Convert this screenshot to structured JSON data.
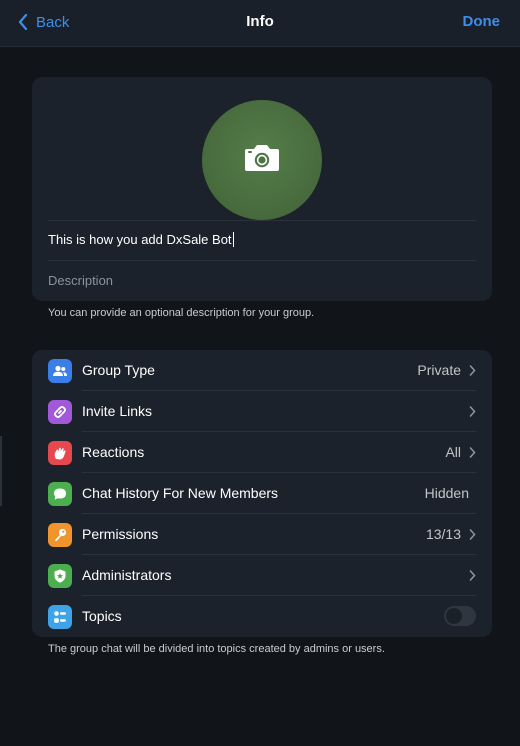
{
  "header": {
    "back_label": "Back",
    "title": "Info",
    "done_label": "Done"
  },
  "profile": {
    "group_name": "This is how you add DxSale Bot",
    "description_placeholder": "Description",
    "description_hint": "You can provide an optional description for your group."
  },
  "settings": {
    "rows": [
      {
        "label": "Group Type",
        "value": "Private",
        "icon": "people-icon",
        "color": "#3a7ee8"
      },
      {
        "label": "Invite Links",
        "value": "",
        "icon": "link-icon",
        "color": "#a259d9"
      },
      {
        "label": "Reactions",
        "value": "All",
        "icon": "reaction-icon",
        "color": "#e5484d"
      },
      {
        "label": "Chat History For New Members",
        "value": "Hidden",
        "icon": "chat-bubble-icon",
        "color": "#4cae4f"
      },
      {
        "label": "Permissions",
        "value": "13/13",
        "icon": "key-icon",
        "color": "#f0952b"
      },
      {
        "label": "Administrators",
        "value": "",
        "icon": "shield-icon",
        "color": "#4cae4f"
      },
      {
        "label": "Topics",
        "value": "",
        "icon": "topics-icon",
        "color": "#3fa3e8",
        "toggle_on": false
      }
    ],
    "topics_hint": "The group chat will be divided into topics created by admins or users."
  }
}
